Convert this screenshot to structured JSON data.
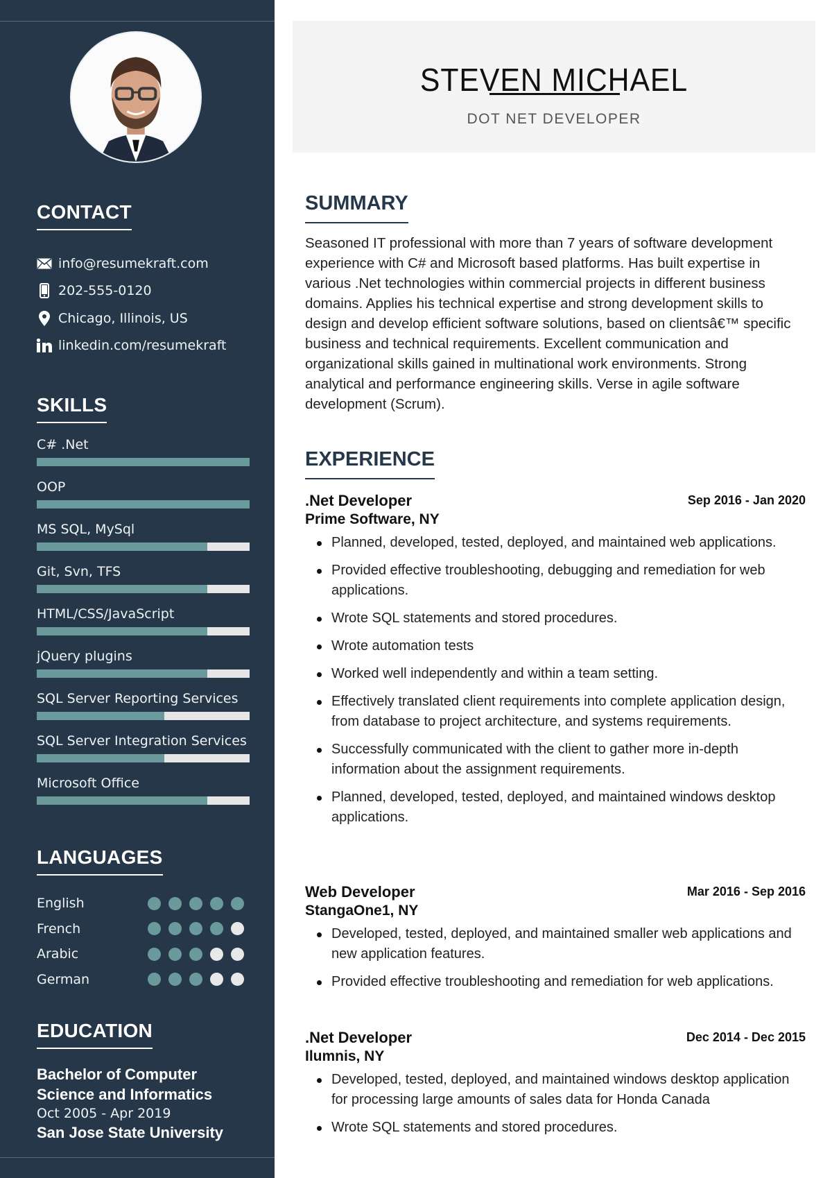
{
  "header": {
    "name": "STEVEN MICHAEL",
    "job_title": "DOT NET DEVELOPER"
  },
  "photo": {
    "alt": "profile-photo"
  },
  "colors": {
    "sidebar_bg": "#253748",
    "accent": "#6b9a9d",
    "track": "#e6e6e6",
    "header_bg": "#f4f4f4",
    "heading": "#253748"
  },
  "contact": {
    "title": "CONTACT",
    "items": [
      {
        "icon": "envelope-icon",
        "text": "info@resumekraft.com"
      },
      {
        "icon": "mobile-phone-icon",
        "text": "202-555-0120"
      },
      {
        "icon": "map-pin-icon",
        "text": "Chicago, Illinois, US"
      },
      {
        "icon": "linkedin-icon",
        "text": "linkedin.com/resumekraft"
      }
    ]
  },
  "skills": {
    "title": "SKILLS",
    "items": [
      {
        "name": "C# .Net",
        "level": 1.0
      },
      {
        "name": "OOP",
        "level": 1.0
      },
      {
        "name": "MS SQL, MySql",
        "level": 0.8
      },
      {
        "name": "Git, Svn, TFS",
        "level": 0.8
      },
      {
        "name": "HTML/CSS/JavaScript",
        "level": 0.8
      },
      {
        "name": "jQuery plugins",
        "level": 0.8
      },
      {
        "name": "SQL Server Reporting Services",
        "level": 0.6
      },
      {
        "name": "SQL Server Integration Services",
        "level": 0.6
      },
      {
        "name": "Microsoft Office",
        "level": 0.8
      }
    ]
  },
  "languages": {
    "title": "LANGUAGES",
    "max_rating": 5,
    "items": [
      {
        "name": "English",
        "rating": 5
      },
      {
        "name": "French",
        "rating": 4
      },
      {
        "name": "Arabic",
        "rating": 3
      },
      {
        "name": "German",
        "rating": 3
      }
    ]
  },
  "education": {
    "title": "EDUCATION",
    "degree": "Bachelor of Computer Science and Informatics",
    "dates": "Oct 2005 - Apr 2019",
    "school": "San Jose State University"
  },
  "summary": {
    "title": "SUMMARY",
    "text": "Seasoned IT professional with more than 7 years of software development experience with C# and Microsoft based platforms. Has built expertise in various .Net technologies within commercial projects in different business domains. Applies his technical expertise and strong development skills to design and develop efficient software solutions, based on clientsâ€™ specific business and technical requirements. Excellent communication and organizational skills gained in multinational work environments. Strong analytical and performance engineering skills. Verse in agile software development (Scrum)."
  },
  "experience": {
    "title": "EXPERIENCE",
    "jobs": [
      {
        "role": ".Net Developer",
        "dates": "Sep 2016 - Jan 2020",
        "company": "Prime Software, NY",
        "bullets": [
          "Planned, developed, tested, deployed, and maintained web applications.",
          "Provided effective troubleshooting, debugging and remediation for web applications.",
          "Wrote SQL statements and stored procedures.",
          "Wrote automation tests",
          "Worked well independently and within a team setting.",
          "Effectively translated client requirements into complete application design, from database to project architecture, and systems requirements.",
          "Successfully communicated with the client to gather more in-depth information about the assignment requirements.",
          "Planned, developed, tested, deployed, and maintained windows desktop applications."
        ]
      },
      {
        "role": "Web Developer",
        "dates": "Mar 2016 - Sep 2016",
        "company": "StangaOne1, NY",
        "bullets": [
          "Developed, tested, deployed, and maintained smaller web applications and new application features.",
          "Provided effective troubleshooting and remediation for web applications."
        ]
      },
      {
        "role": ".Net Developer",
        "dates": "Dec 2014 - Dec 2015",
        "company": "Ilumnis, NY",
        "bullets": [
          "Developed, tested, deployed, and maintained windows desktop application for processing large amounts of sales data for Honda Canada",
          "Wrote SQL statements and stored procedures."
        ]
      }
    ]
  }
}
